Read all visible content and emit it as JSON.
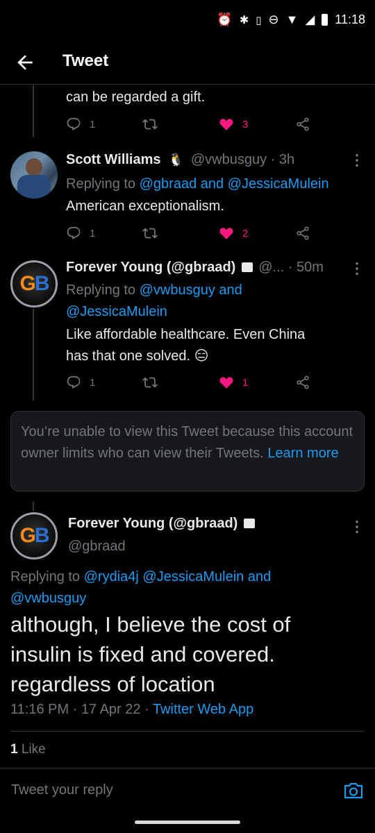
{
  "status_bar": {
    "time": "11:18"
  },
  "header": {
    "title": "Tweet"
  },
  "tweet_prev": {
    "text": "can be regarded a gift.",
    "replies": "1",
    "likes": "3"
  },
  "tweet_scott": {
    "name": "Scott Williams",
    "emoji": "🐧",
    "handle_time": "@vwbusguy · 3h",
    "replying_prefix": "Replying to ",
    "replying_to": "@gbraad and @JessicaMulein",
    "text": "American exceptionalism.",
    "replies": "1",
    "likes": "2"
  },
  "tweet_gbraad": {
    "name": "Forever Young (@gbraad)",
    "handle_time": "@... · 50m",
    "replying_prefix": "Replying to ",
    "replying_to_1": "@vwbusguy and",
    "replying_to_2": "@JessicaMulein",
    "text_1": "Like affordable healthcare. Even China",
    "text_2": "has that one solved.",
    "emoji": "😑",
    "replies": "1",
    "likes": "1"
  },
  "notice": {
    "text": "You’re unable to view this Tweet because this account owner limits who can view their Tweets.",
    "link": "Learn more"
  },
  "main_tweet": {
    "name": "Forever Young (@gbraad)",
    "handle": "@gbraad",
    "replying_prefix": "Replying to ",
    "replying_to_1": "@rydia4j @JessicaMulein and",
    "replying_to_2": "@vwbusguy",
    "text_1": "although, I believe the cost of",
    "text_2": "insulin is fixed and covered.",
    "text_3": "regardless of location",
    "timestamp": "11:16 PM · 17 Apr 22 · ",
    "source": "Twitter Web App",
    "like_count": "1",
    "like_label": " Like"
  },
  "reply_bar": {
    "placeholder": "Tweet your reply"
  },
  "colors": {
    "accent": "#1d9bf0",
    "like": "#f91880",
    "background": "#000000",
    "muted": "#71767b"
  },
  "icons": [
    "back-arrow-icon",
    "reply-icon",
    "retweet-icon",
    "heart-icon",
    "share-icon",
    "more-icon",
    "lock-icon",
    "camera-icon"
  ]
}
